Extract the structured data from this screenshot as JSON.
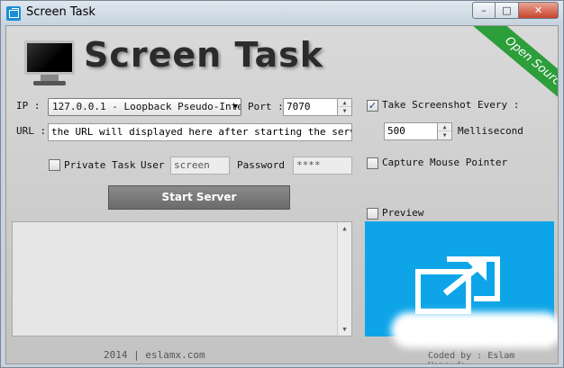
{
  "window": {
    "title": "Screen Task",
    "buttons": {
      "minimize": "–",
      "maximize": "□",
      "close": "✕"
    }
  },
  "header": {
    "logo_text": "Screen Task",
    "ribbon_text": "Open Source"
  },
  "form": {
    "ip_label": "IP :",
    "ip_value": "127.0.0.1 - Loopback Pseudo-Inte",
    "port_label": "Port :",
    "port_value": "7070",
    "url_label": "URL :",
    "url_value": "the URL will displayed here after starting the server...",
    "private_task_label": "Private Task",
    "private_task_checked": false,
    "user_label": "User :",
    "user_value": "screen",
    "password_label": "Password :",
    "password_value": "****",
    "start_button": "Start Server"
  },
  "options": {
    "screenshot_label": "Take Screenshot Every :",
    "screenshot_checked": true,
    "interval_value": "500",
    "interval_unit": "Mellisecond",
    "capture_mouse_label": "Capture Mouse Pointer",
    "capture_mouse_checked": false,
    "preview_label": "Preview",
    "preview_checked": false
  },
  "footer": {
    "left": "2014 | eslamx.com",
    "right": "Coded by : Eslam Hamouda"
  },
  "colors": {
    "ribbon": "#2c9e3a",
    "preview_bg": "#0ea5e8",
    "button": "#777777"
  },
  "icons": {
    "app": "screen-share-icon",
    "logo": "monitor-icon",
    "preview": "screen-share-icon"
  }
}
